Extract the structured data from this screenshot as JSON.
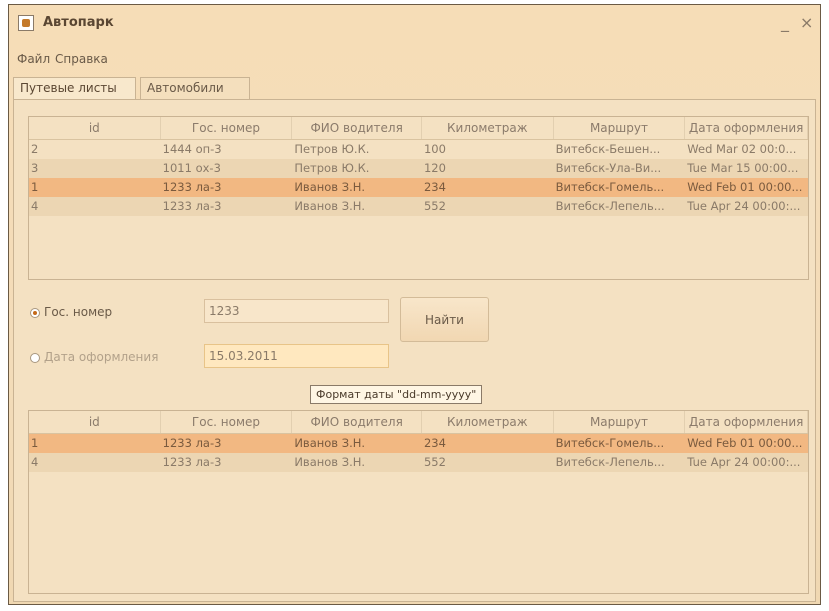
{
  "window": {
    "title": "Автопарк",
    "minimize_label": "_",
    "close_label": "×"
  },
  "menu": {
    "items": [
      "Файл",
      "Справка"
    ]
  },
  "tabs": [
    {
      "label": "Путевые листы",
      "active": true
    },
    {
      "label": "Автомобили",
      "active": false
    }
  ],
  "table_columns": [
    "id",
    "Гос. номер",
    "ФИО водителя",
    "Километраж",
    "Маршрут",
    "Дата оформления"
  ],
  "top_table": {
    "rows": [
      [
        "2",
        "1444 оп-3",
        "Петров Ю.К.",
        "100",
        "Витебск-Бешен...",
        "Wed Mar 02 00:0..."
      ],
      [
        "3",
        "1011 ох-3",
        "Петров Ю.К.",
        "120",
        "Витебск-Ула-Ви...",
        "Tue Mar 15 00:00..."
      ],
      [
        "1",
        "1233 ла-3",
        "Иванов З.Н.",
        "234",
        "Витебск-Гомель...",
        "Wed Feb 01 00:00..."
      ],
      [
        "4",
        "1233 ла-3",
        "Иванов З.Н.",
        "552",
        "Витебск-Лепель...",
        "Tue Apr 24 00:00:..."
      ]
    ],
    "selected_row": 2
  },
  "search": {
    "plate_radio_label": "Гос. номер",
    "plate_value": "1233",
    "date_radio_label": "Дата оформления",
    "date_value": "15.03.2011",
    "find_button_label": "Найти",
    "tooltip": "Формат даты \"dd-mm-yyyy\""
  },
  "bottom_table": {
    "rows": [
      [
        "1",
        "1233 ла-3",
        "Иванов З.Н.",
        "234",
        "Витебск-Гомель...",
        "Wed Feb 01 00:00..."
      ],
      [
        "4",
        "1233 ла-3",
        "Иванов З.Н.",
        "552",
        "Витебск-Лепель...",
        "Tue Apr 24 00:00:..."
      ]
    ],
    "selected_row": 0
  }
}
